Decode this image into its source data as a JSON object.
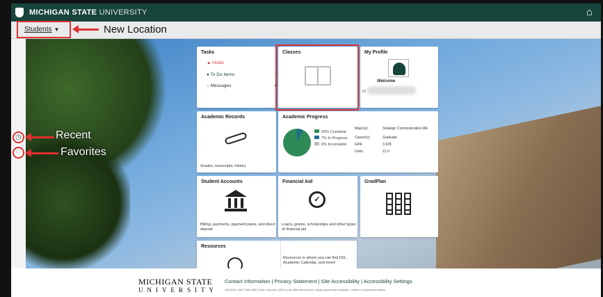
{
  "header": {
    "university": "MICHIGAN STATE",
    "university_light": "UNIVERSITY",
    "home_icon": "home-icon"
  },
  "subbar": {
    "students_label": "Students",
    "new_location_annotation": "New Location",
    "prev_icon": "chevron-left-icon",
    "next_icon": "chevron-right-icon"
  },
  "side": {
    "recent_label": "Recent",
    "favorites_label": "Favorites",
    "recent_icon": "clock-icon",
    "favorites_icon": "heart-icon"
  },
  "tiles": {
    "tasks": {
      "title": "Tasks",
      "items": [
        {
          "label": "Holds",
          "count": "1",
          "color": "#d23b3b"
        },
        {
          "label": "To Do Items",
          "count": "1",
          "color": "#18453b"
        },
        {
          "label": "Messages",
          "count": "0",
          "color": "#333333"
        }
      ]
    },
    "classes": {
      "title": "Classes"
    },
    "profile": {
      "title": "My Profile",
      "welcome": "Welcome",
      "id_label": "ID"
    },
    "records": {
      "title": "Academic Records",
      "caption": "Grades, transcripts, history"
    },
    "progress": {
      "title": "Academic Progress",
      "legend": [
        {
          "label": "93% Complete",
          "color": "#2e8b57"
        },
        {
          "label": "7% In Progress",
          "color": "#1f6f8b"
        },
        {
          "label": "0% Incomplete",
          "color": "#bbbbbb"
        }
      ],
      "details": [
        {
          "k": "Major(s):",
          "v": "Strategic Communication MA"
        },
        {
          "k": "Career(s):",
          "v": "Graduate"
        },
        {
          "k": "GPA:",
          "v": "3.928"
        },
        {
          "k": "Units:",
          "v": "21.0"
        }
      ],
      "pie": {
        "complete": 93,
        "in_progress": 7,
        "incomplete": 0
      }
    },
    "accounts": {
      "title": "Student Accounts",
      "caption": "Billing, payments, payment plans, and direct deposit"
    },
    "aid": {
      "title": "Financial Aid",
      "caption": "Loans, grants, scholarships and other types of financial aid"
    },
    "gradplan": {
      "title": "GradPlan"
    },
    "resources": {
      "title": "Resources",
      "caption": "Resources is where you can find D2L, Academic Calendar, and more!"
    }
  },
  "footer": {
    "msu_line1": "MICHIGAN STATE",
    "msu_line2": "UNIVERSITY",
    "links": "Contact Information | Privacy Statement | Site Accessibility | Accessibility Settings",
    "fine": "Call MSU: (517) 355-1855 | Visit: msu.edu | MSU is an affirmative-action, equal-opportunity employer. | Notice of Nondiscrimination"
  }
}
